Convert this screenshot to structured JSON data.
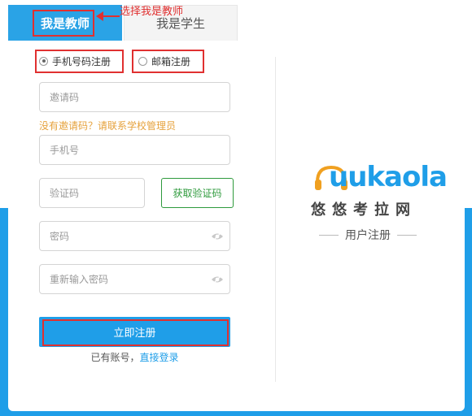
{
  "tabs": {
    "teacher": "我是教师",
    "student": "我是学生"
  },
  "annotation": "选择我是教师",
  "register_method": {
    "phone": "手机号码注册",
    "email": "邮箱注册",
    "selected": "phone"
  },
  "form": {
    "invite_placeholder": "邀请码",
    "no_invite_hint": "没有邀请码？请联系学校管理员",
    "phone_placeholder": "手机号",
    "code_placeholder": "验证码",
    "get_code_label": "获取验证码",
    "password_placeholder": "密码",
    "confirm_password_placeholder": "重新输入密码",
    "submit_label": "立即注册",
    "have_account": "已有账号，",
    "login_link": "直接登录"
  },
  "brand": {
    "logo_text": "uukaola",
    "logo_cn": "悠悠考拉网",
    "page_title": "用户注册"
  },
  "colors": {
    "accent": "#1f9ee8",
    "annotation": "#e03030",
    "hint": "#e6a23c",
    "code_button": "#2e9a3c"
  },
  "icons": {
    "password_toggle": "eye-icon",
    "annotation_arrow": "arrow-left-icon"
  }
}
